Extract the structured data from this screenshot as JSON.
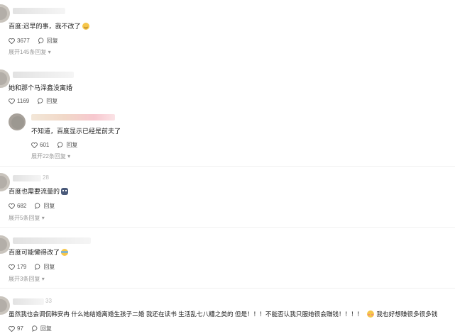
{
  "comments": [
    {
      "text": "百度:迟早的事，我不改了",
      "emoji": "smiling-face-icon",
      "likes": "3677",
      "reply_label": "回复",
      "expand_label": "展开145条回复"
    },
    {
      "text": "她和那个马泽鑫没离婚",
      "likes": "1169",
      "reply_label": "回复"
    },
    {
      "text": "不知道，百度显示已经是前夫了",
      "likes": "601",
      "reply_label": "回复",
      "expand_label": "展开22条回复"
    },
    {
      "user_tag": "28",
      "text": "百度也需要流量的",
      "emoji": "robot-face-icon",
      "likes": "682",
      "reply_label": "回复",
      "expand_label": "展开5条回复"
    },
    {
      "text": "百度可能懒得改了",
      "emoji": "rolling-laughing-face-icon",
      "likes": "179",
      "reply_label": "回复",
      "expand_label": "展开3条回复"
    },
    {
      "user_tag": "33",
      "text": "虽然我也会调侃韩安冉 什么她结婚离婚生孩子二婚 我还在读书 生活乱七八糟之类的 但是！！！不能否认我只服她很会赚钱！！！！",
      "emoji": "shy-face-icon",
      "text_after_emoji": "我也好想赚很多很多钱",
      "likes": "97",
      "reply_label": "回复"
    }
  ]
}
